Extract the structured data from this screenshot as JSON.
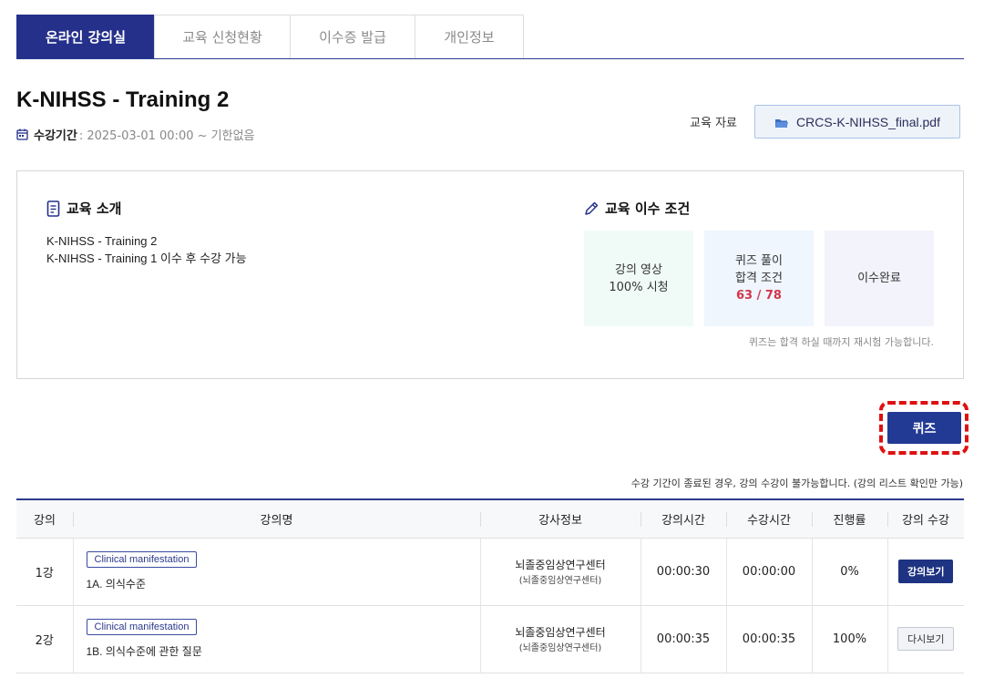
{
  "tabs": [
    {
      "label": "온라인 강의실",
      "active": true
    },
    {
      "label": "교육 신청현황",
      "active": false
    },
    {
      "label": "이수증 발급",
      "active": false
    },
    {
      "label": "개인정보",
      "active": false
    }
  ],
  "course": {
    "title": "K-NIHSS - Training 2",
    "period_label": "수강기간",
    "period_value": " : 2025-03-01 00:00 ~ 기한없음"
  },
  "material": {
    "label": "교육 자료",
    "file": "CRCS-K-NIHSS_final.pdf"
  },
  "intro": {
    "heading": "교육 소개",
    "line1": "K-NIHSS - Training 2",
    "line2": "K-NIHSS - Training 1 이수 후 수강 가능"
  },
  "conditions": {
    "heading": "교육 이수 조건",
    "card1_line1": "강의 영상",
    "card1_line2": "100% 시청",
    "card2_line1": "퀴즈 풀이",
    "card2_line2": "합격 조건",
    "card2_score": "63 / 78",
    "card3": "이수완료",
    "note": "퀴즈는 합격 하실 때까지 재시험 가능합니다."
  },
  "quiz_button": "퀴즈",
  "notice": "수강 기간이 종료된 경우, 강의 수강이 불가능합니다. (강의 리스트 확인만 가능)",
  "table": {
    "headers": [
      "강의",
      "강의명",
      "강사정보",
      "강의시간",
      "수강시간",
      "진행률",
      "강의 수강"
    ],
    "rows": [
      {
        "no": "1강",
        "tag": "Clinical manifestation",
        "name": "1A. 의식수준",
        "inst1": "뇌졸중임상연구센터",
        "inst2": "(뇌졸중임상연구센터)",
        "duration": "00:00:30",
        "watched": "00:00:00",
        "progress": "0%",
        "action": "강의보기"
      },
      {
        "no": "2강",
        "tag": "Clinical manifestation",
        "name": "1B. 의식수준에 관한 질문",
        "inst1": "뇌졸중임상연구센터",
        "inst2": "(뇌졸중임상연구센터)",
        "duration": "00:00:35",
        "watched": "00:00:35",
        "progress": "100%",
        "action": "다시보기"
      }
    ]
  },
  "colors": {
    "primary": "#24308a",
    "accent_red": "#d1364a",
    "highlight": "#e01010"
  },
  "icons": {
    "calendar": "calendar-icon",
    "folder": "folder-icon",
    "document": "document-icon",
    "pencil": "pencil-icon"
  }
}
